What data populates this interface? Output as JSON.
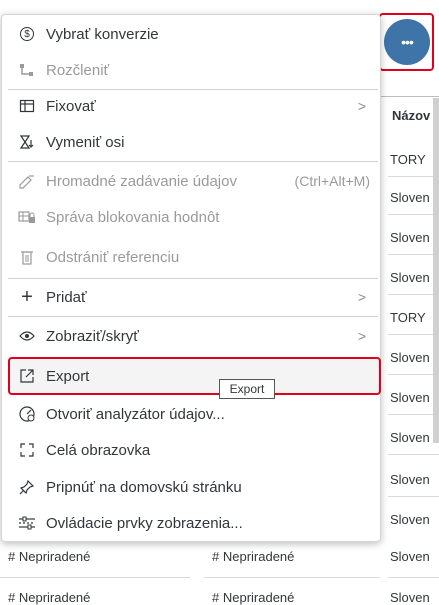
{
  "menu": {
    "items": [
      {
        "label": "Vybrať konverzie",
        "icon": "currency-icon"
      },
      {
        "label": "Rozčleniť",
        "icon": "hierarchy-icon"
      },
      {
        "label": "Fixovať",
        "icon": "freeze-icon"
      },
      {
        "label": "Vymeniť osi",
        "icon": "swap-axes-icon"
      },
      {
        "label": "Hromadné zadávanie údajov",
        "shortcut": "(Ctrl+Alt+M)",
        "icon": "mass-entry-icon"
      },
      {
        "label": "Správa blokovania hodnôt",
        "icon": "lock-table-icon"
      },
      {
        "label": "Odstrániť referenciu",
        "icon": "trash-icon"
      },
      {
        "label": "Pridať",
        "icon": "plus-icon"
      },
      {
        "label": "Zobraziť/skryť",
        "icon": "eye-icon"
      },
      {
        "label": "Export",
        "icon": "export-icon"
      },
      {
        "label": "Otvoriť analyzátor údajov...",
        "icon": "analyzer-icon"
      },
      {
        "label": "Celá obrazovka",
        "icon": "fullscreen-icon"
      },
      {
        "label": "Pripnúť na domovskú stránku",
        "icon": "pin-icon"
      },
      {
        "label": "Ovládacie prvky zobrazenia...",
        "icon": "view-controls-icon"
      }
    ],
    "tooltip": "Export"
  },
  "more_button": {
    "label": "•••"
  },
  "table": {
    "header": "Názov",
    "cells": [
      "TORY",
      "Sloven",
      "Sloven",
      "Sloven",
      "TORY",
      "Sloven",
      "Sloven",
      "Sloven",
      "Sloven",
      "Sloven",
      "Sloven",
      "Sloven"
    ],
    "bottom_rows": [
      [
        "# Nepriradené",
        "# Nepriradené",
        "Sloven"
      ],
      [
        "# Nepriradené",
        "# Nepriradené",
        "Sloven"
      ]
    ]
  },
  "colors": {
    "accent": "#3f74a8",
    "highlight": "#e0001b"
  }
}
